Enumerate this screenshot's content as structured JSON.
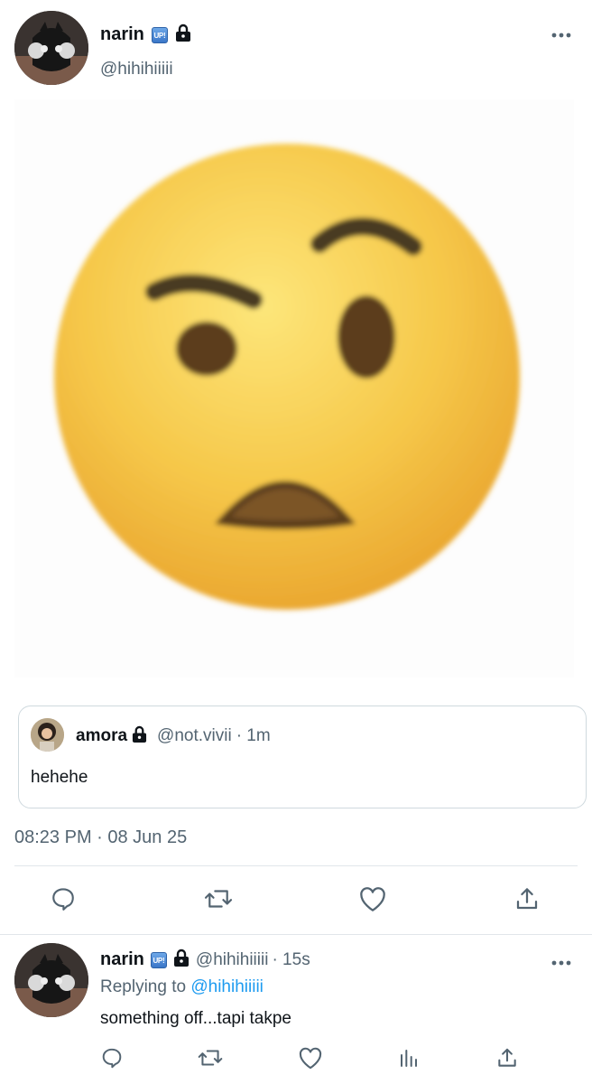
{
  "tweet": {
    "author_name": "narin",
    "badge_text": "UP!",
    "author_handle": "@hihihiiiii",
    "media_icon": "raised-eyebrow-face-emoji",
    "timestamp": "08:23 PM · 08 Jun 25",
    "more_icon": "more-icon"
  },
  "quote": {
    "author_name": "amora",
    "author_handle": "@not.vivii",
    "time": "· 1m",
    "text": "hehehe"
  },
  "actions": [
    "reply-icon",
    "retweet-icon",
    "like-icon",
    "share-icon"
  ],
  "reply": {
    "author_name": "narin",
    "badge_text": "UP!",
    "author_handle": "@hihihiiiii",
    "time": "· 15s",
    "replying_prefix": "Replying to",
    "replying_handle": "@hihihiiiii",
    "text": "something off...tapi takpe"
  },
  "reply_actions": [
    "reply-icon",
    "retweet-icon",
    "like-icon",
    "analytics-icon",
    "share-icon"
  ],
  "colors": {
    "link": "#1d9bf0",
    "muted": "#536471",
    "border": "#cfd9de"
  }
}
